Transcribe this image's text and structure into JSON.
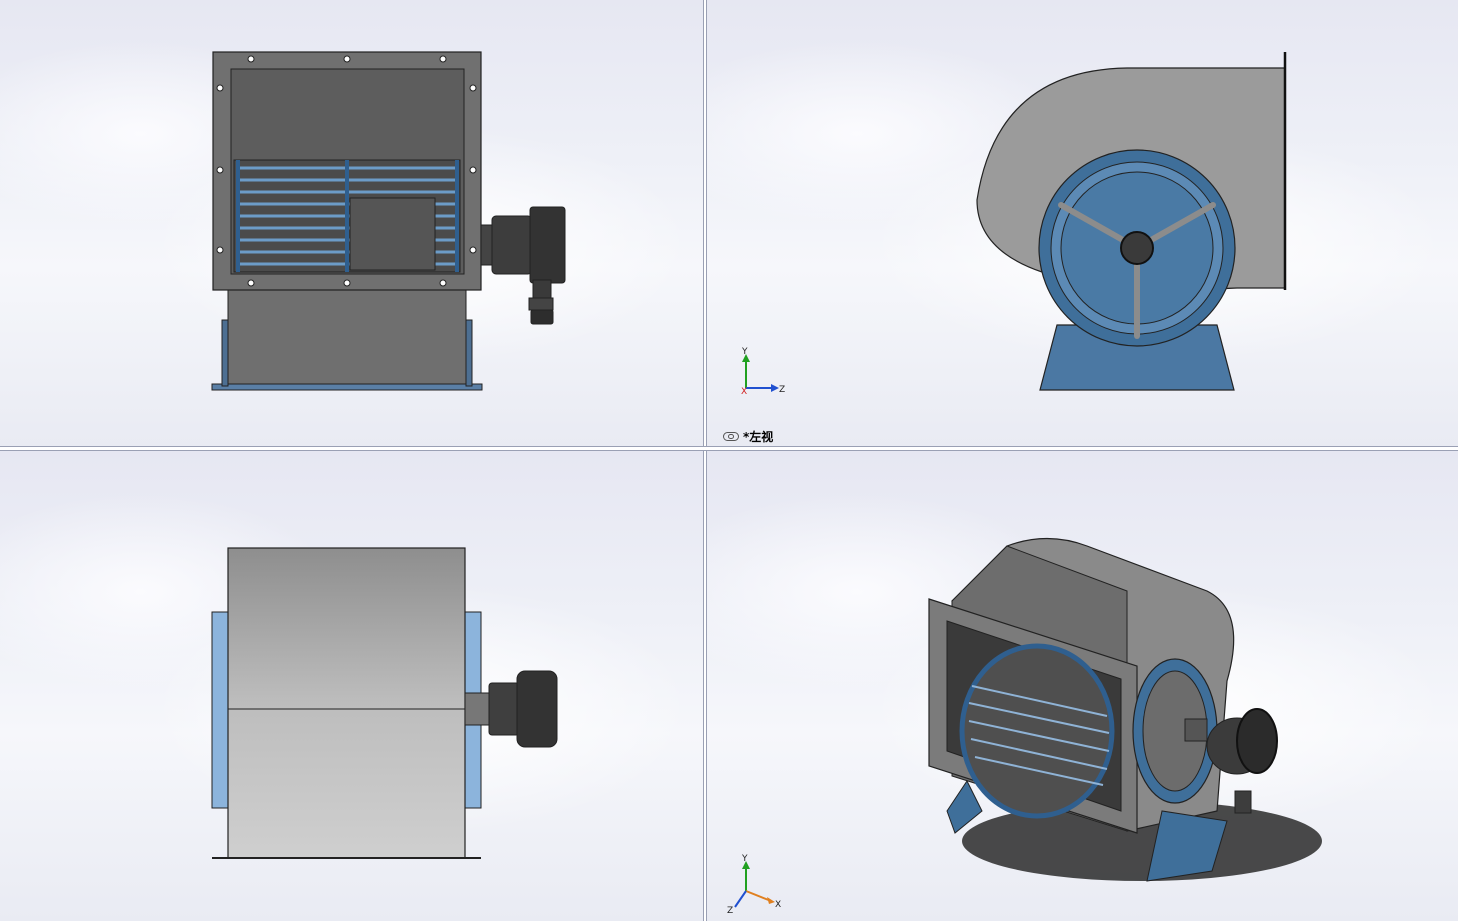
{
  "viewports": {
    "top_left": {
      "view": "front"
    },
    "top_right": {
      "view": "left",
      "label": "*左视",
      "triad": {
        "up": "Y",
        "right": "Z",
        "origin": "X"
      }
    },
    "bottom_left": {
      "view": "top"
    },
    "bottom_right": {
      "view": "isometric",
      "triad": {
        "up": "Y",
        "right": "X",
        "origin": "Z"
      }
    }
  },
  "colors": {
    "housing_gray": "#6b6b6b",
    "housing_light": "#9a9a9a",
    "impeller_blue": "#3f6f9a",
    "motor_dark": "#3a3a3a",
    "axis_x": "#d02020",
    "axis_y": "#20a020",
    "axis_z": "#2050d0"
  },
  "icons": {
    "view_icon": "glasses-icon"
  }
}
